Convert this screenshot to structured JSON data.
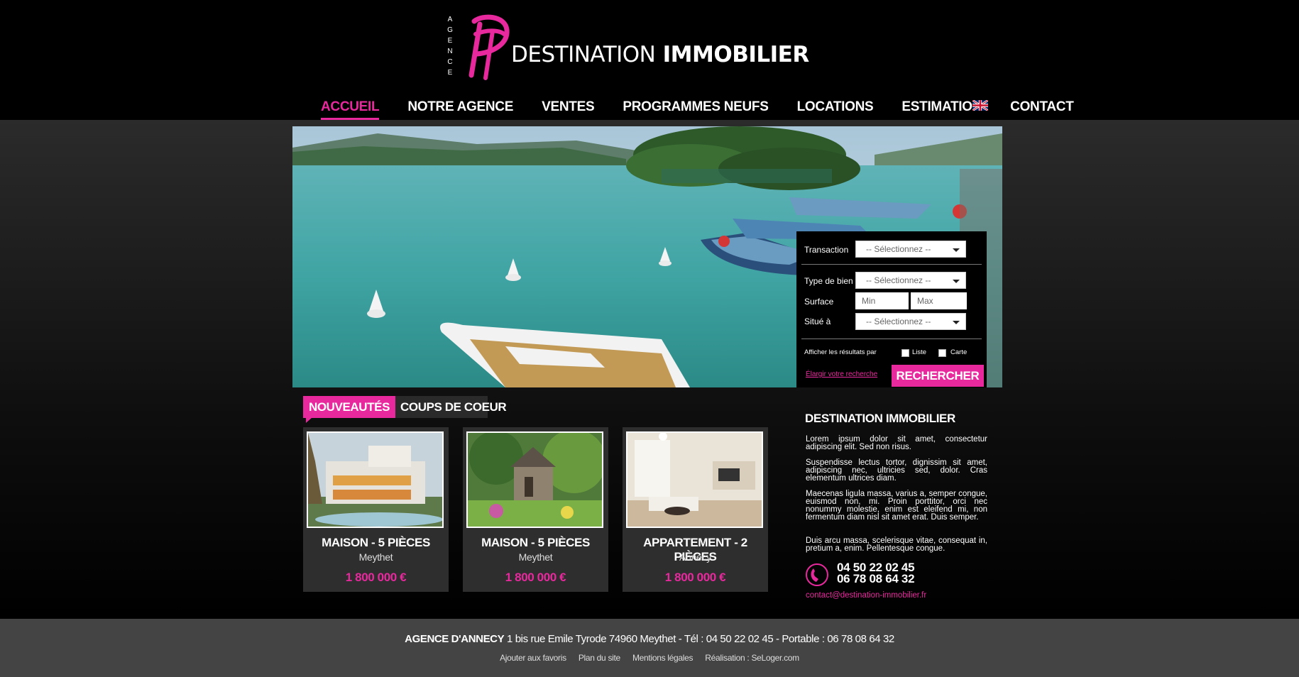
{
  "header": {
    "agence_letters": [
      "A",
      "G",
      "E",
      "N",
      "C",
      "E"
    ],
    "brand_light": "DESTINATION",
    "brand_bold": "IMMOBILIER"
  },
  "nav": {
    "items": [
      {
        "label": "ACCUEIL",
        "active": true
      },
      {
        "label": "NOTRE AGENCE"
      },
      {
        "label": "VENTES"
      },
      {
        "label": "PROGRAMMES NEUFS"
      },
      {
        "label": "LOCATIONS"
      },
      {
        "label": "ESTIMATION"
      },
      {
        "label": "CONTACT"
      }
    ],
    "language_flag": "uk-flag-icon"
  },
  "search": {
    "transaction_label": "Transaction",
    "transaction_value": "-- Sélectionnez --",
    "type_label": "Type de bien",
    "type_value": "-- Sélectionnez --",
    "surface_label": "Surface",
    "surface_min_placeholder": "Min",
    "surface_max_placeholder": "Max",
    "location_label": "Situé à",
    "location_value": "-- Sélectionnez --",
    "display_label": "Afficher les résultats par",
    "option_list": "Liste",
    "option_map": "Carte",
    "broaden_link": "Élargir votre recherche",
    "submit_label": "RECHERCHER"
  },
  "tabs": [
    {
      "label": "NOUVEAUTÉS",
      "active": true
    },
    {
      "label": "COUPS DE COEUR"
    }
  ],
  "listings": [
    {
      "title": "MAISON - 5 PIÈCES",
      "city": "Meythet",
      "price": "1 800 000 €"
    },
    {
      "title": "MAISON - 5 PIÈCES",
      "city": "Meythet",
      "price": "1 800 000 €"
    },
    {
      "title": "APPARTEMENT - 2 PIÈCES",
      "city": "Annecy",
      "price": "1 800 000 €"
    }
  ],
  "about": {
    "title": "DESTINATION IMMOBILIER",
    "paragraphs": [
      "Lorem ipsum dolor sit amet, consectetur adipiscing elit. Sed non risus.",
      "Suspendisse lectus tortor, dignissim sit amet, adipiscing nec, ultricies sed, dolor. Cras elementum ultrices diam.",
      "Maecenas ligula massa, varius a, semper congue, euismod non, mi. Proin porttitor, orci nec nonummy molestie, enim est eleifend mi, non fermentum diam nisl sit amet erat. Duis semper.",
      "Duis arcu massa, scelerisque vitae, consequat in, pretium a, enim. Pellentesque congue."
    ],
    "phone1": "04 50 22 02 45",
    "phone2": "06 78 08 64 32",
    "email": "contact@destination-immobilier.fr"
  },
  "footer": {
    "agency": "AGENCE D'ANNECY",
    "address": " 1 bis rue Emile Tyrode 74960 Meythet  - Tél : 04 50 22 02 45 - Portable : 06 78 08 64 32",
    "links": [
      "Ajouter aux favoris",
      "Plan du site",
      "Mentions légales",
      "Réalisation : SeLoger.com"
    ]
  },
  "colors": {
    "accent": "#e8299e",
    "background": "#000000",
    "footer": "#444444",
    "card": "#2e2e2e"
  }
}
